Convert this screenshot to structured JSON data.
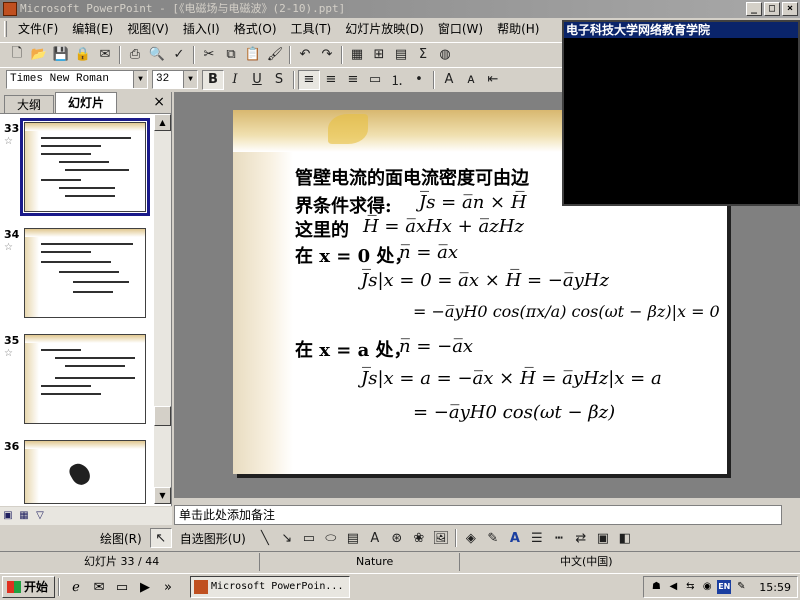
{
  "window": {
    "title": "Microsoft PowerPoint - [《电磁场与电磁波》(2-10).ppt]",
    "controls": [
      "_",
      "□",
      "×"
    ]
  },
  "menu": {
    "items": [
      "文件(F)",
      "编辑(E)",
      "视图(V)",
      "插入(I)",
      "格式(O)",
      "工具(T)",
      "幻灯片放映(D)",
      "窗口(W)",
      "帮助(H)"
    ]
  },
  "format_bar": {
    "font": "Times New Roman",
    "size": "32",
    "bold": "B",
    "italic": "I",
    "underline": "U",
    "shadow": "S"
  },
  "left_pane": {
    "tabs": [
      "大纲",
      "幻灯片"
    ],
    "active_tab": "幻灯片",
    "close": "×",
    "slides": [
      {
        "num": "33",
        "selected": true
      },
      {
        "num": "34",
        "selected": false
      },
      {
        "num": "35",
        "selected": false
      },
      {
        "num": "36",
        "selected": false
      }
    ]
  },
  "slide": {
    "line1": "管壁电流的面电流密度可由边",
    "line2_text": "界条件求得:",
    "line2_eq": "J̅s = a̅n × H̅",
    "line3_text": "这里的",
    "line3_eq": "H̅ = a̅xHx + a̅zHz",
    "line4_text": "在 x = 0 处，",
    "line4_eq": "n̅ = a̅x",
    "line5_eq": "J̅s|x = 0 = a̅x × H̅ = −a̅yHz",
    "line6_eq": "= −a̅yH0 cos(πx/a) cos(ωt − βz)|x = 0",
    "line7_text": "在 x = a 处，",
    "line7_eq": "n̅ = −a̅x",
    "line8_eq": "J̅s|x = a = −a̅x × H̅ = a̅yHz|x = a",
    "line9_eq": "= −a̅yH0 cos(ωt − βz)"
  },
  "notes": {
    "placeholder": "单击此处添加备注"
  },
  "draw_bar": {
    "draw_label": "绘图(R)",
    "autoshape_label": "自选图形(U)"
  },
  "status_bar": {
    "slide_info": "幻灯片 33 / 44",
    "design": "Nature",
    "language": "中文(中国)"
  },
  "taskbar": {
    "start": "开始",
    "task_item": "Microsoft PowerPoin...",
    "time": "15:59",
    "ime": "EN"
  },
  "video_overlay": {
    "title": "电子科技大学网络教育学院"
  }
}
